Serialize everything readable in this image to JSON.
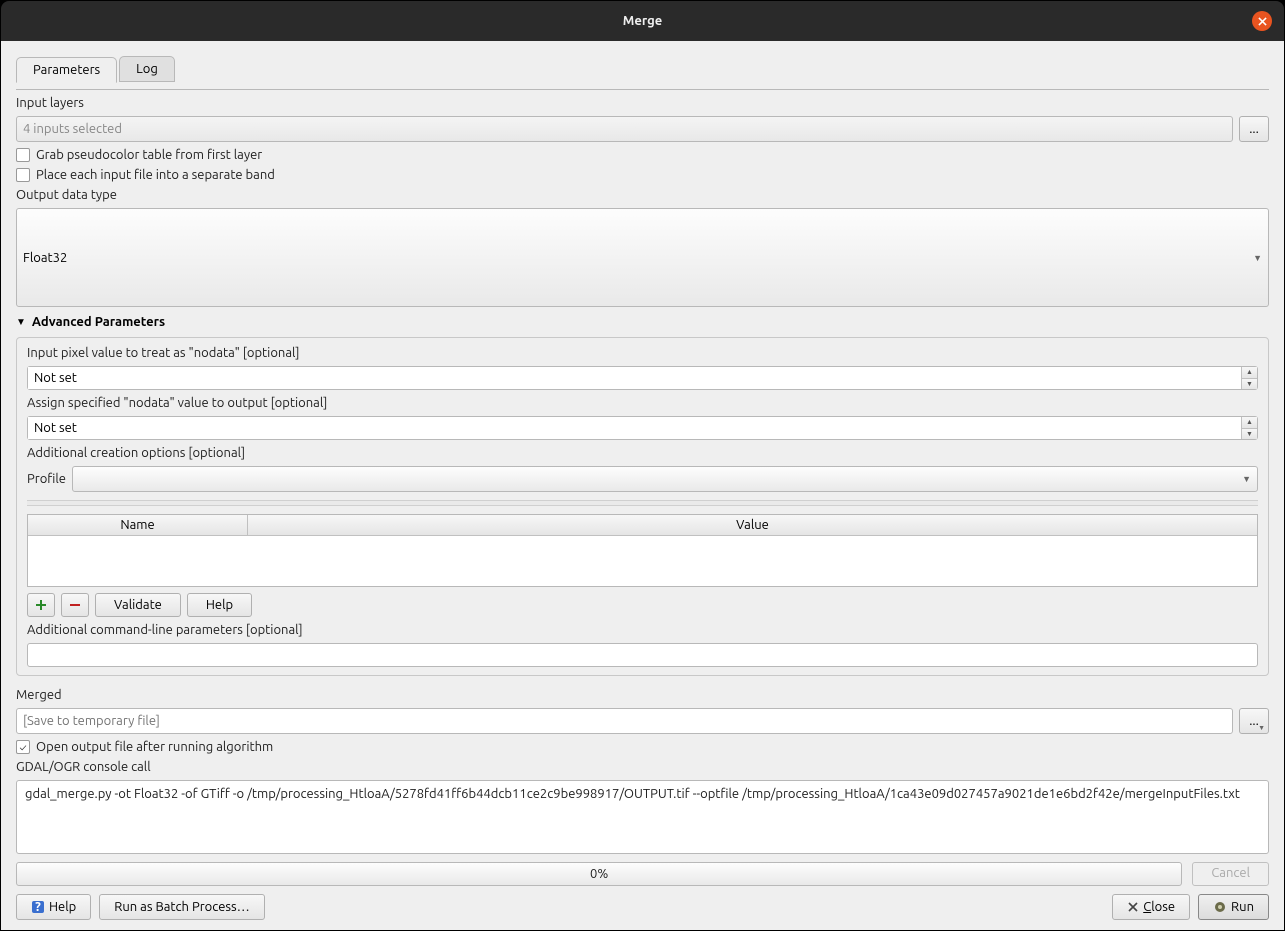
{
  "window": {
    "title": "Merge"
  },
  "tabs": {
    "parameters": "Parameters",
    "log": "Log"
  },
  "inputLayers": {
    "label": "Input layers",
    "value": "4 inputs selected",
    "browse": "..."
  },
  "checks": {
    "grabPseudo": "Grab pseudocolor table from first layer",
    "separateBand": "Place each input file into a separate band",
    "openOutput": "Open output file after running algorithm"
  },
  "outputDataType": {
    "label": "Output data type",
    "value": "Float32"
  },
  "advanced": {
    "header": "Advanced Parameters",
    "nodataIn": {
      "label": "Input pixel value to treat as \"nodata\" [optional]",
      "value": "Not set"
    },
    "nodataOut": {
      "label": "Assign specified \"nodata\" value to output [optional]",
      "value": "Not set"
    },
    "creationOpts": {
      "label": "Additional creation options [optional]",
      "profileLabel": "Profile",
      "profileValue": ""
    },
    "table": {
      "name": "Name",
      "value": "Value"
    },
    "buttons": {
      "validate": "Validate",
      "help": "Help"
    },
    "extraCli": {
      "label": "Additional command-line parameters [optional]",
      "value": ""
    }
  },
  "merged": {
    "label": "Merged",
    "placeholder": "[Save to temporary file]"
  },
  "console": {
    "label": "GDAL/OGR console call",
    "text": "gdal_merge.py -ot Float32 -of GTiff -o /tmp/processing_HtloaA/5278fd41ff6b44dcb11ce2c9be998917/OUTPUT.tif --optfile /tmp/processing_HtloaA/1ca43e09d027457a9021de1e6bd2f42e/mergeInputFiles.txt"
  },
  "progress": {
    "text": "0%",
    "cancel": "Cancel"
  },
  "footer": {
    "help": "Help",
    "batch": "Run as Batch Process…",
    "close_pre": "",
    "close_und": "C",
    "close_post": "lose",
    "run": "Run"
  }
}
